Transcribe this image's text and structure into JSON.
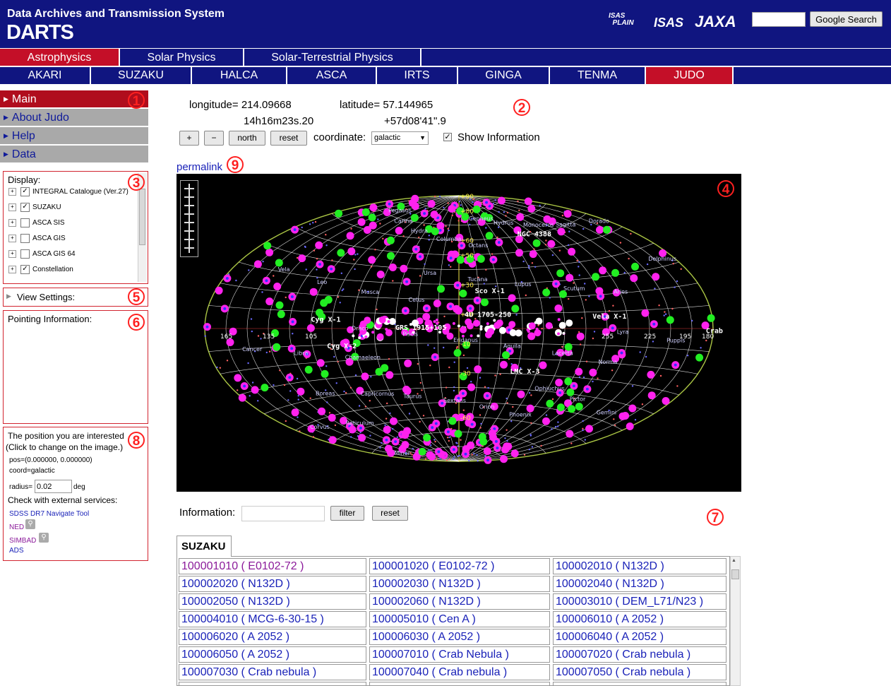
{
  "header": {
    "subtitle": "Data Archives and Transmission System",
    "title": "DARTS",
    "logos": [
      "ISAS PLAIN",
      "ISAS",
      "JAXA"
    ],
    "search_button": "Google Search",
    "search_value": ""
  },
  "nav": {
    "categories": [
      "Astrophysics",
      "Solar Physics",
      "Solar-Terrestrial Physics"
    ],
    "missions": [
      "AKARI",
      "SUZAKU",
      "HALCA",
      "ASCA",
      "IRTS",
      "GINGA",
      "TENMA",
      "JUDO"
    ]
  },
  "sidebar": {
    "menu": [
      "Main",
      "About Judo",
      "Help",
      "Data"
    ],
    "display_label": "Display:",
    "layers": [
      {
        "label": "INTEGRAL Catalogue (Ver.27)",
        "checked": true
      },
      {
        "label": "SUZAKU",
        "checked": true
      },
      {
        "label": "ASCA SIS",
        "checked": false
      },
      {
        "label": "ASCA GIS",
        "checked": false
      },
      {
        "label": "ASCA GIS 64",
        "checked": false
      },
      {
        "label": "Constellation",
        "checked": true
      }
    ],
    "view_settings": "View Settings:",
    "pointing_info": "Pointing Information:",
    "position_title": "The position you are interested",
    "position_hint": "(Click to change on the image.)",
    "pos": "pos=(0.000000, 0.000000)",
    "coord": "coord=galactic",
    "radius_label": "radius=",
    "radius_value": "0.02",
    "radius_unit": "deg",
    "external_label": "Check with external services:",
    "external": [
      "SDSS DR7 Navigate Tool",
      "NED",
      "SIMBAD",
      "ADS"
    ]
  },
  "viewer": {
    "longitude_label": "longitude=",
    "longitude": "214.09668",
    "latitude_label": "latitude=",
    "latitude": "57.144965",
    "ra": "14h16m23s.20",
    "dec": "+57d08'41\".9",
    "btn_plus": "+",
    "btn_minus": "−",
    "btn_north": "north",
    "btn_reset": "reset",
    "coordinate_label": "coordinate:",
    "coordinate_value": "galactic",
    "show_info_label": "Show Information",
    "show_info_checked": true,
    "permalink": "permalink"
  },
  "sky_labels": {
    "lat_ticks": [
      "+90",
      "+80",
      "+60",
      "+50",
      "+30",
      "+10",
      "-10",
      "-30",
      "-60"
    ],
    "lon_ticks": [
      "165",
      "135",
      "105",
      "255",
      "225",
      "195",
      "180"
    ],
    "sources": [
      "NGC 4388",
      "Sco X-1",
      "4U 1705-250",
      "Cyg X-1",
      "Cyg X-2",
      "Vela X-1",
      "Crab",
      "LMC X-3",
      "GRS 1915+105"
    ],
    "constellations": [
      "Minor",
      "Boreas",
      "Draco",
      "Ursa",
      "Cepheus",
      "Ophiuchus",
      "Lyra",
      "Delphinus",
      "Pegasus",
      "Capricornus",
      "Piscis",
      "Tucana",
      "Hydrus",
      "Pictor",
      "Puppis",
      "Vela",
      "Carina",
      "Taurus",
      "Eridanus",
      "Lupus",
      "Monoceros",
      "Gemini",
      "Cancer",
      "Leo",
      "Hydra",
      "Sextans",
      "Aquila",
      "Scutum",
      "Sagitta",
      "Corvus",
      "Libra",
      "Musca",
      "Columba",
      "Orion",
      "Lacerta",
      "Aries",
      "Dorado",
      "Reticulum",
      "Chamaeleon",
      "Cetus",
      "Octans",
      "Phoenix",
      "Norma"
    ]
  },
  "info_filter": {
    "label": "Information:",
    "value": "",
    "filter_btn": "filter",
    "reset_btn": "reset"
  },
  "tab": "SUZAKU",
  "observations": [
    [
      "100001010 ( E0102-72 )",
      "100001020 ( E0102-72 )",
      "100002010 ( N132D )"
    ],
    [
      "100002020 ( N132D )",
      "100002030 ( N132D )",
      "100002040 ( N132D )"
    ],
    [
      "100002050 ( N132D )",
      "100002060 ( N132D )",
      "100003010 ( DEM_L71/N23 )"
    ],
    [
      "100004010 ( MCG-6-30-15 )",
      "100005010 ( Cen A )",
      "100006010 ( A 2052 )"
    ],
    [
      "100006020 ( A 2052 )",
      "100006030 ( A 2052 )",
      "100006040 ( A 2052 )"
    ],
    [
      "100006050 ( A 2052 )",
      "100007010 ( Crab Nebula )",
      "100007020 ( Crab nebula )"
    ],
    [
      "100007030 ( Crab nebula )",
      "100007040 ( Crab nebula )",
      "100007050 ( Crab nebula )"
    ]
  ],
  "annotations": [
    "1",
    "2",
    "3",
    "4",
    "5",
    "6",
    "7",
    "8",
    "9"
  ],
  "colors": {
    "header_bg": "#101580",
    "active_red": "#c40f28",
    "annotation_red": "#ff2020",
    "link_blue": "#1a22b8",
    "visited_purple": "#8b1a9a",
    "source_magenta": "#ff22ee",
    "source_green": "#22ee22"
  }
}
